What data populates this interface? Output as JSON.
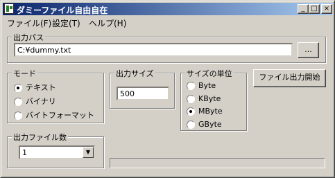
{
  "window": {
    "title": "ダミーファイル自由自在",
    "minimize_glyph": "_",
    "maximize_glyph": "□",
    "close_glyph": "×"
  },
  "menu": {
    "items": [
      "ファイル(F)",
      "設定(T)",
      "ヘルプ(H)"
    ]
  },
  "output_path": {
    "label": "出力パス",
    "value": "C:¥dummy.txt",
    "browse_label": "..."
  },
  "mode": {
    "label": "モード",
    "options": [
      "テキスト",
      "バイナリ",
      "バイトフォーマット"
    ],
    "selected_index": 0
  },
  "output_size": {
    "label": "出力サイズ",
    "value": "500"
  },
  "size_unit": {
    "label": "サイズの単位",
    "options": [
      "Byte",
      "KByte",
      "MByte",
      "GByte"
    ],
    "selected_index": 2
  },
  "start_button": {
    "label": "ファイル出力開始"
  },
  "file_count": {
    "label": "出力ファイル数",
    "selected": "1"
  },
  "progress": {
    "value": 0
  }
}
